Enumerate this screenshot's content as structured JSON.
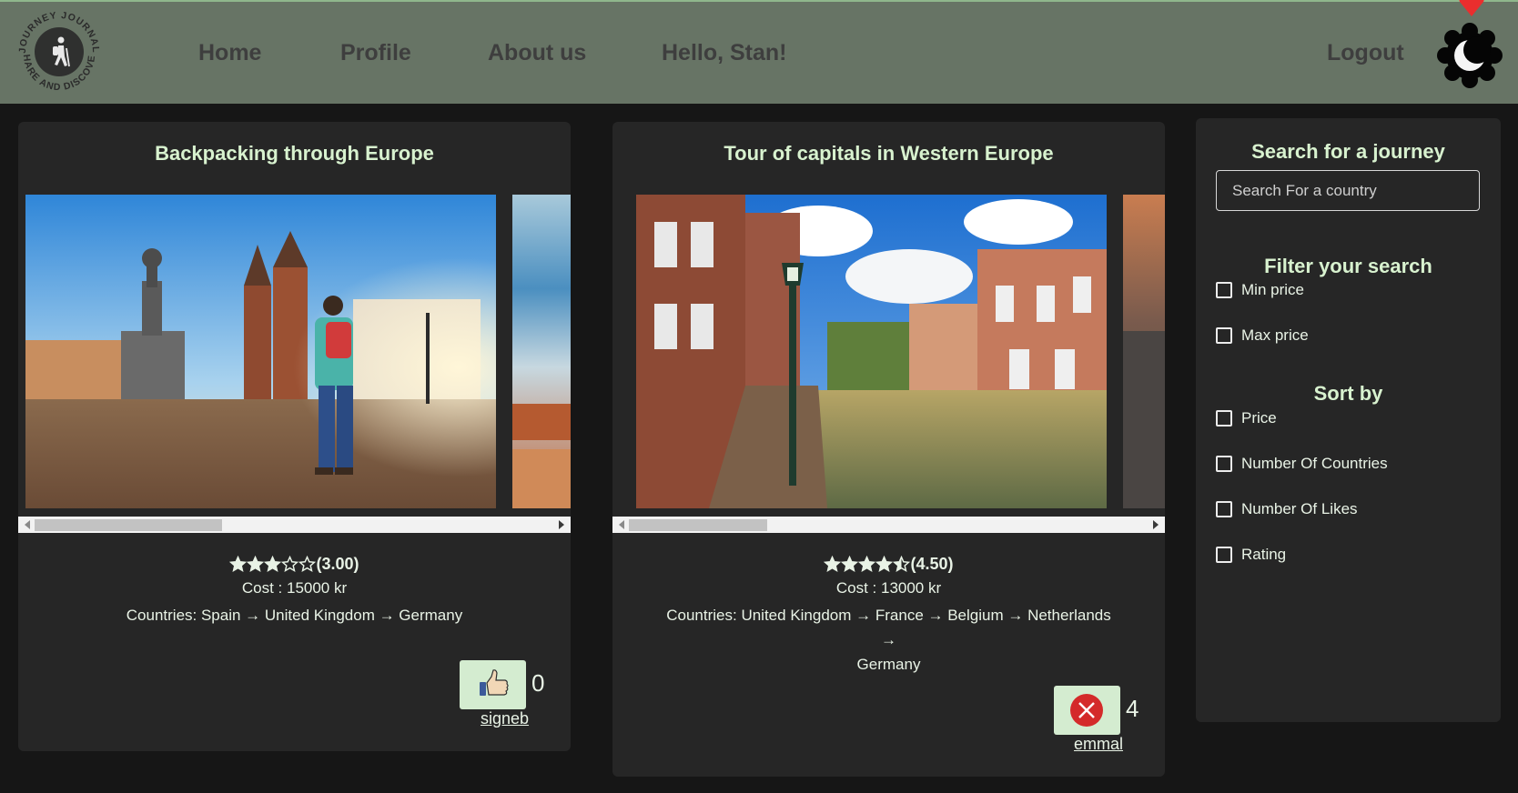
{
  "nav": {
    "logo_text": "JOURNEY JOURNAL · SHARE AND DISCOVER",
    "home": "Home",
    "profile": "Profile",
    "about": "About us",
    "greeting": "Hello, Stan!",
    "logout": "Logout"
  },
  "colors": {
    "navbar": "#677465",
    "card": "#262626",
    "page": "#161616",
    "title": "#d8f2cf",
    "like_button": "#d4ecd0"
  },
  "journeys": [
    {
      "title": "Backpacking through Europe",
      "rating_value": 3.0,
      "rating_label": "(3.00)",
      "cost": "Cost : 15000 kr",
      "countries_line1": "Countries: Spain → United Kingdom → Germany",
      "countries_line2": "",
      "like_icon": "thumbs-up-icon",
      "likes": "0",
      "author": "signeb"
    },
    {
      "title": "Tour of capitals in Western Europe",
      "rating_value": 4.5,
      "rating_label": "(4.50)",
      "cost": "Cost : 13000 kr",
      "countries_line1": "Countries: United Kingdom → France → Belgium → Netherlands →",
      "countries_line2": "Germany",
      "like_icon": "close-icon",
      "likes": "4",
      "author": "emmal"
    }
  ],
  "sidebar": {
    "search_title": "Search for a journey",
    "search_placeholder": "Search For a country",
    "filter_title": "Filter your search",
    "filters": [
      "Min price",
      "Max price"
    ],
    "sort_title": "Sort by",
    "sort_options": [
      "Price",
      "Number Of Countries",
      "Number Of Likes",
      "Rating"
    ]
  }
}
